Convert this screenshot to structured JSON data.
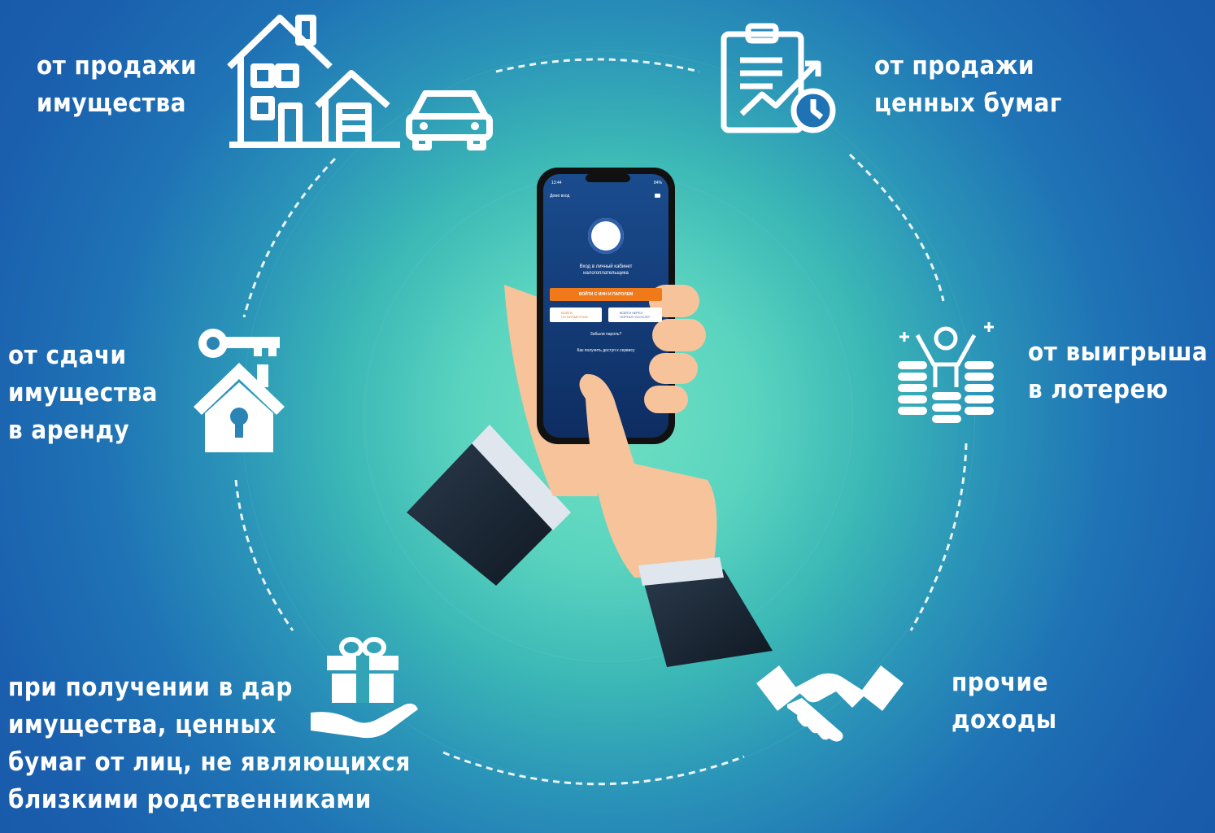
{
  "labels": {
    "property_sale": "от продажи\nимущества",
    "securities_sale": "от продажи\nценных бумаг",
    "rent": "от сдачи\nимущества\nв аренду",
    "lottery": "от выигрыша\nв лотерею",
    "gift": "при получении в дар\nимущества, ценных\nбумаг от лиц, не являющихся\nблизкими родственниками",
    "other": "прочие\nдоходы"
  },
  "phone": {
    "status_time": "13:44",
    "status_battery": "84%",
    "demo_link": "Демо вход",
    "heading": "Вход в личный кабинет\nналогоплательщика",
    "login_inn_button": "ВОЙТИ С ИНН И ПАРОЛЕМ",
    "biometric_button": "ВОЙТИ\nПО БИОМЕТРИИ",
    "gosuslugi_button": "ВОЙТИ ЧЕРЕЗ\nПОРТАЛ ГОСУСЛУГ",
    "forgot_password": "Забыли пароль?",
    "access_help": "Как получить доступ к сервису"
  },
  "colors": {
    "bg_center": "#6fe0c2",
    "bg_edge": "#1856a8",
    "label": "#ffffff",
    "phone_screen": "#123a7a",
    "accent_button": "#f07a1a",
    "sleeve": "#1c2a3a",
    "skin": "#f6c39a"
  },
  "icons": [
    "house-icon",
    "car-icon",
    "document-chart-icon",
    "key-house-icon",
    "lottery-winner-icon",
    "gift-hand-icon",
    "handshake-icon",
    "tax-service-emblem-icon"
  ]
}
